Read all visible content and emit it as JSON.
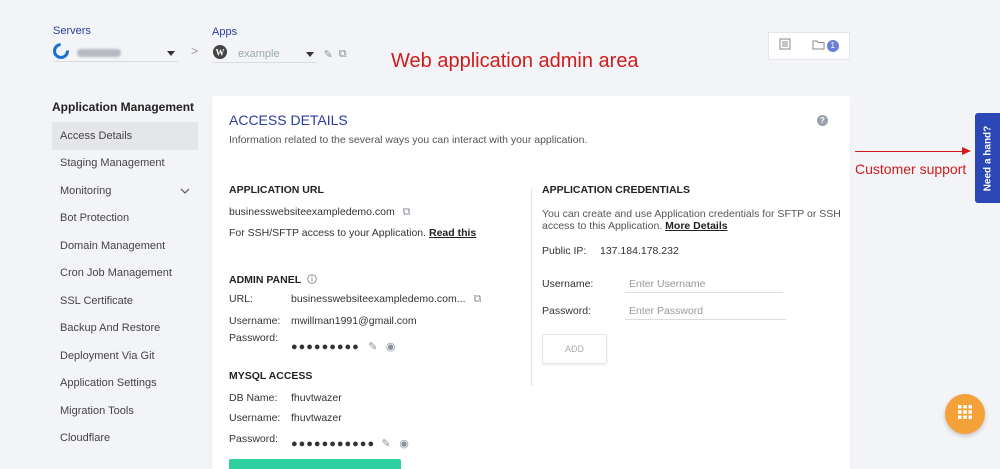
{
  "header": {
    "servers_label": "Servers",
    "apps_label": "Apps",
    "app_selected": "example",
    "breadcrumb_separator": ">",
    "badge_count": "1"
  },
  "annotations": {
    "title": "Web application admin area",
    "support": "Customer support"
  },
  "sidebar": {
    "heading": "Application Management",
    "items": [
      {
        "label": "Access Details"
      },
      {
        "label": "Staging Management"
      },
      {
        "label": "Monitoring"
      },
      {
        "label": "Bot Protection"
      },
      {
        "label": "Domain Management"
      },
      {
        "label": "Cron Job Management"
      },
      {
        "label": "SSL Certificate"
      },
      {
        "label": "Backup And Restore"
      },
      {
        "label": "Deployment Via Git"
      },
      {
        "label": "Application Settings"
      },
      {
        "label": "Migration Tools"
      },
      {
        "label": "Cloudflare"
      }
    ]
  },
  "main": {
    "title": "ACCESS DETAILS",
    "description": "Information related to the several ways you can interact with your application.",
    "help_icon": "?",
    "app_url": {
      "heading": "APPLICATION URL",
      "url": "businesswebsiteexampledemo.com",
      "ssh_text": "For SSH/SFTP access to your Application.",
      "read_this": "Read this"
    },
    "admin_panel": {
      "heading": "ADMIN PANEL",
      "url_label": "URL:",
      "url_value": "businesswebsiteexampledemo.com...",
      "username_label": "Username:",
      "username_value": "mwillman1991@gmail.com",
      "password_label": "Password:",
      "password_value": "●●●●●●●●●"
    },
    "mysql": {
      "heading": "MYSQL ACCESS",
      "db_label": "DB Name:",
      "db_value": "fhuvtwazer",
      "username_label": "Username:",
      "username_value": "fhuvtwazer",
      "password_label": "Password:",
      "password_value": "●●●●●●●●●●●"
    },
    "credentials": {
      "heading": "APPLICATION CREDENTIALS",
      "desc1": "You can create and use Application credentials for SFTP or SSH",
      "desc2": "access to this Application.",
      "more_details": "More Details",
      "public_ip_label": "Public IP:",
      "public_ip_value": "137.184.178.232",
      "username_label": "Username:",
      "username_placeholder": "Enter Username",
      "password_label": "Password:",
      "password_placeholder": "Enter Password",
      "add_button": "ADD"
    }
  },
  "support_tab": "Need a hand?",
  "colors": {
    "primary": "#2b3b9e",
    "annotation": "#d11b1b",
    "support_tab": "#2b46b5",
    "fab": "#f5a13a",
    "cta": "#2fd0a0"
  }
}
